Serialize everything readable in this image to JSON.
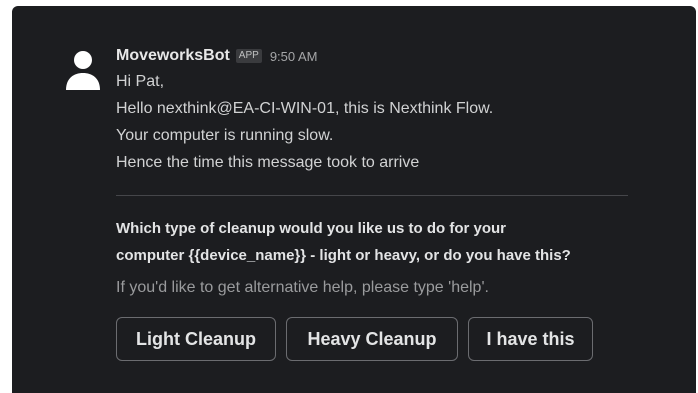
{
  "message": {
    "sender": "MoveworksBot",
    "badge": "APP",
    "timestamp": "9:50 AM",
    "avatar_icon": "user-silhouette-icon",
    "lines": [
      "Hi Pat,",
      "Hello nexthink@EA-CI-WIN-01, this is Nexthink Flow.",
      "Your computer is running slow.",
      "Hence the time this message took to arrive"
    ]
  },
  "prompt": {
    "question_line1": "Which type of cleanup would you like us to do for your",
    "question_line2": "computer {{device_name}} - light or  heavy, or do you have this?",
    "help_text": "If you'd like to get alternative help, please type 'help'."
  },
  "buttons": {
    "light": "Light Cleanup",
    "heavy": "Heavy Cleanup",
    "have": "I have this"
  },
  "colors": {
    "background": "#1c1d20",
    "text": "#d1d2d3",
    "muted": "#9a9b9d",
    "button_border": "#6b6c70"
  }
}
